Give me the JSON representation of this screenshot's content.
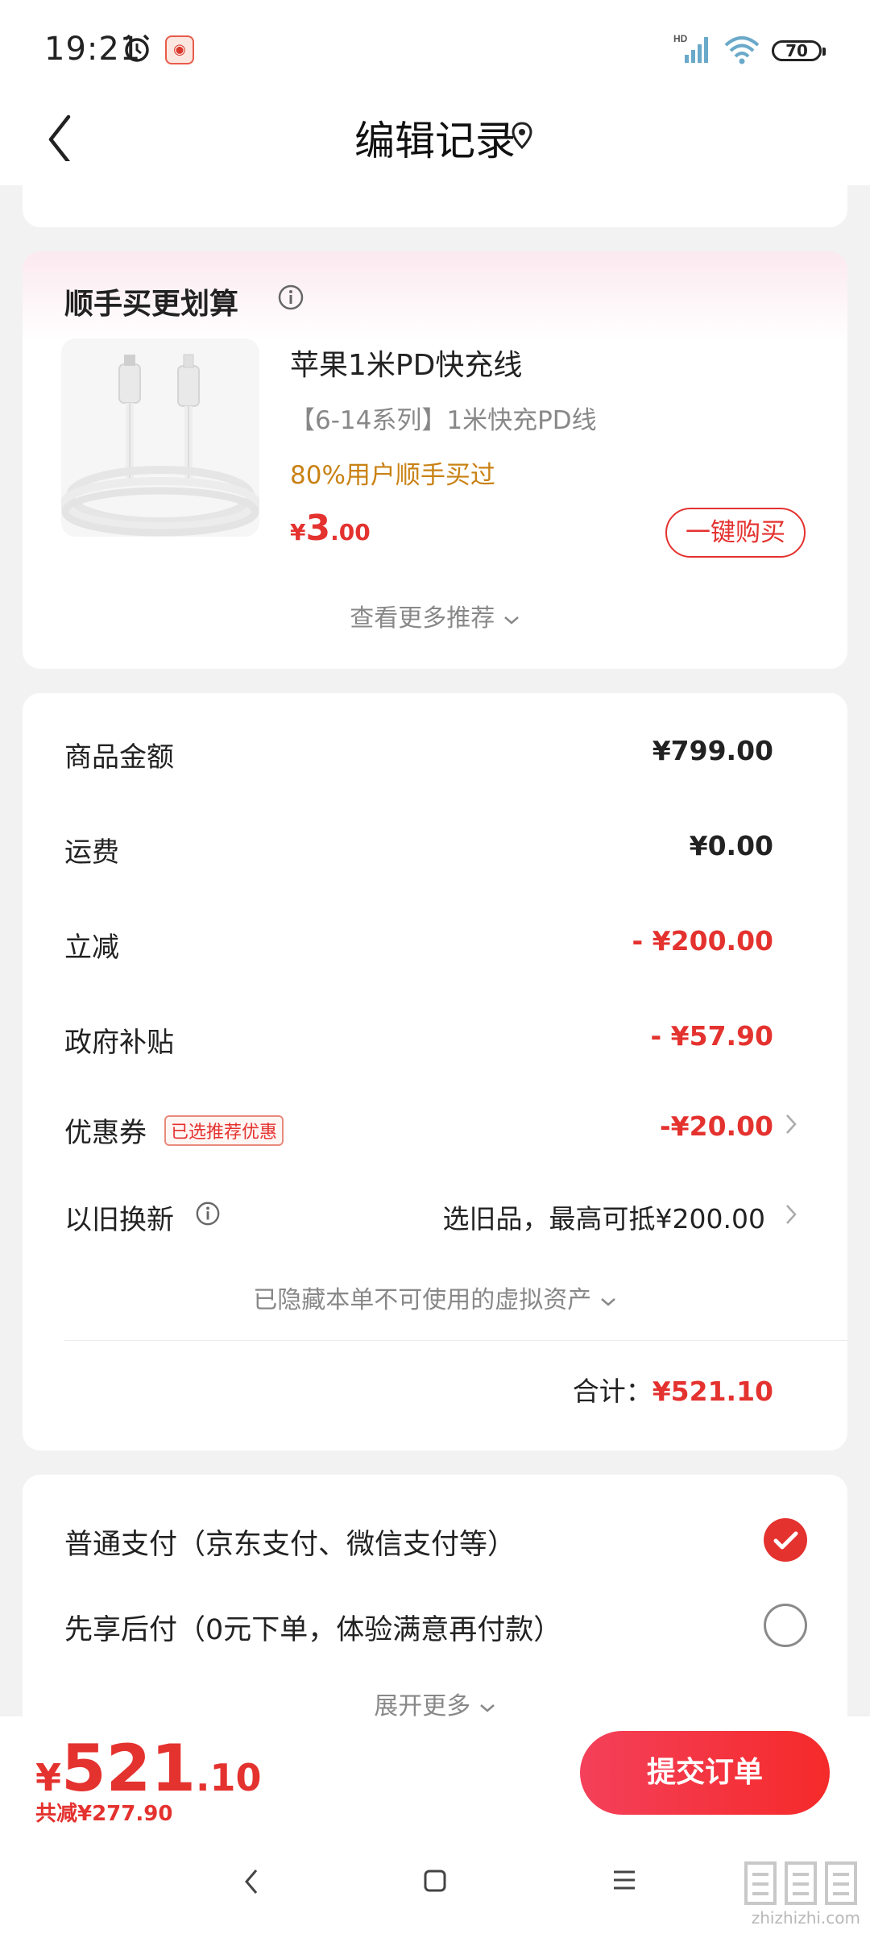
{
  "status_bar": {
    "time": "19:21",
    "battery": "70",
    "signal_label": "HD",
    "icons": [
      "alarm-icon",
      "app-notification-icon",
      "signal-icon",
      "wifi-icon",
      "battery-icon"
    ]
  },
  "nav": {
    "title": "编辑记录",
    "back_icon": "chevron-left-icon",
    "location_icon": "location-pin-icon"
  },
  "recommend": {
    "title": "顺手买更划算",
    "product": {
      "name": "苹果1米PD快充线",
      "desc": "【6-14系列】1米快充PD线",
      "stat": "80%用户顺手买过",
      "price_currency": "¥",
      "price_int": "3",
      "price_dec": ".00",
      "buy_label": "一键购买"
    },
    "more_label": "查看更多推荐"
  },
  "price_detail": {
    "rows": [
      {
        "label": "商品金额",
        "value": "¥799.00"
      },
      {
        "label": "运费",
        "value": "¥0.00"
      },
      {
        "label": "立减",
        "value": "- ¥200.00"
      },
      {
        "label": "政府补贴",
        "value": "- ¥57.90"
      },
      {
        "label": "优惠券",
        "tag": "已选推荐优惠",
        "value": "-¥20.00"
      },
      {
        "label": "以旧换新",
        "value": "选旧品，最高可抵¥200.00"
      }
    ],
    "hidden_assets": "已隐藏本单不可使用的虚拟资产",
    "total_label": "合计：",
    "total_value": "¥521.10"
  },
  "payment": {
    "options": [
      {
        "label": "普通支付（京东支付、微信支付等）",
        "selected": true
      },
      {
        "label": "先享后付（0元下单，体验满意再付款）",
        "selected": false
      }
    ],
    "more_label": "展开更多"
  },
  "bottom_bar": {
    "price_currency": "¥",
    "price_int": "521",
    "price_dec": ".10",
    "saved": "共减¥277.90",
    "submit_label": "提交订单"
  },
  "watermark": {
    "domain": "zhizhizhi.com"
  },
  "colors": {
    "accent": "#e4322f",
    "orange": "#c98214",
    "gray_text": "#888888",
    "background": "#f2f2f2"
  }
}
